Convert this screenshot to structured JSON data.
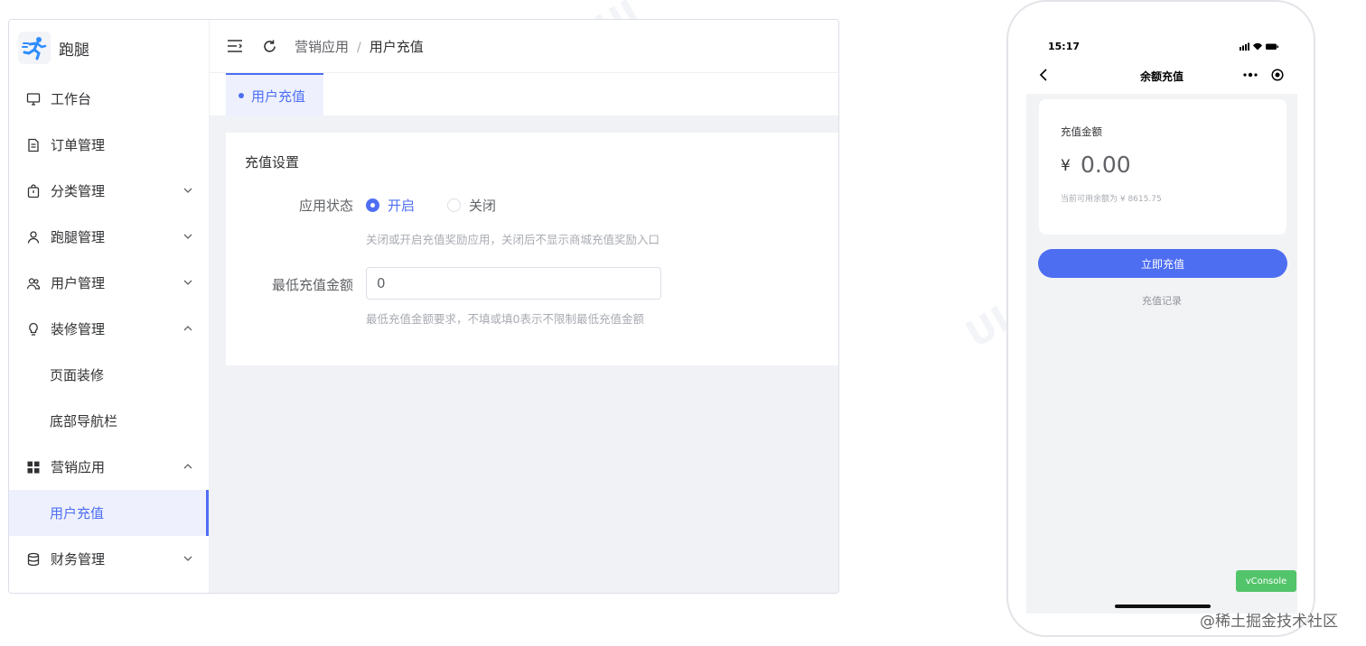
{
  "admin": {
    "brand": "跑腿",
    "menu": [
      {
        "label": "工作台",
        "icon": "monitor-icon"
      },
      {
        "label": "订单管理",
        "icon": "document-icon"
      },
      {
        "label": "分类管理",
        "icon": "bag-icon",
        "expandable": true
      },
      {
        "label": "跑腿管理",
        "icon": "user-icon",
        "expandable": true
      },
      {
        "label": "用户管理",
        "icon": "users-icon",
        "expandable": true
      },
      {
        "label": "装修管理",
        "icon": "bulb-icon",
        "expanded": true
      },
      {
        "label": "页面装修",
        "sub": true
      },
      {
        "label": "底部导航栏",
        "sub": true
      },
      {
        "label": "营销应用",
        "icon": "grid-icon",
        "expanded": true
      },
      {
        "label": "用户充值",
        "sub": true,
        "active": true
      },
      {
        "label": "财务管理",
        "icon": "database-icon",
        "expandable": true
      }
    ],
    "breadcrumb": {
      "parent": "营销应用",
      "separator": "/",
      "current": "用户充值"
    },
    "tab": "用户充值",
    "form": {
      "section_title": "充值设置",
      "status_label": "应用状态",
      "status_on": "开启",
      "status_off": "关闭",
      "status_value": "开启",
      "status_hint": "关闭或开启充值奖励应用，关闭后不显示商城充值奖励入口",
      "min_label": "最低充值金额",
      "min_value": "0",
      "min_hint": "最低充值金额要求，不填或填0表示不限制最低充值金额"
    }
  },
  "phone": {
    "time": "15:17",
    "title": "余额充值",
    "amount_label": "充值金额",
    "currency": "¥",
    "amount_value": "0.00",
    "balance_text": "当前可用余额为 ¥ 8615.75",
    "recharge_button": "立即充值",
    "record_link": "充值记录",
    "vconsole": "vConsole"
  },
  "watermark": "@稀土掘金技术社区",
  "colors": {
    "accent": "#4e6ef2",
    "active_bg": "#eef1fd",
    "vconsole": "#52c46a"
  }
}
